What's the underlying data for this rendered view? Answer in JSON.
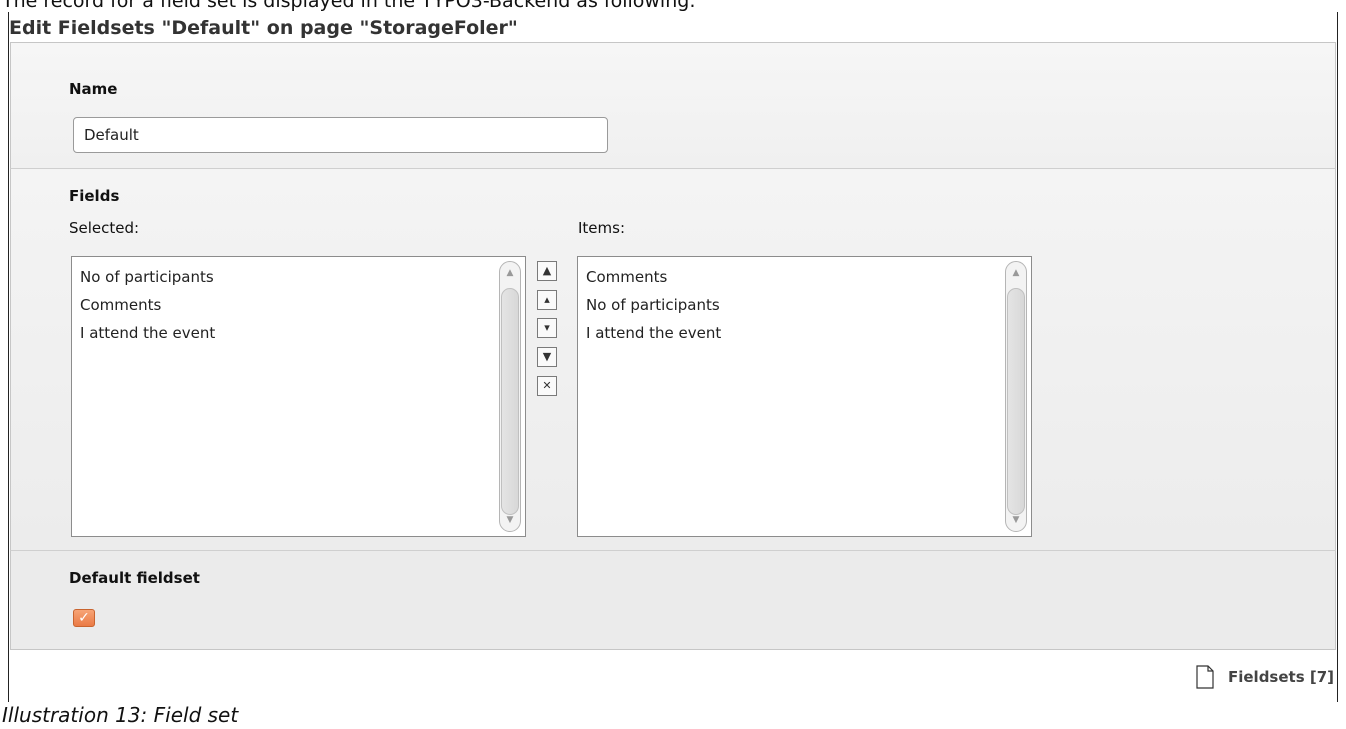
{
  "intro_text": "The record for a field set is displayed in the TYPO3-Backend as following:",
  "header": {
    "title": "Edit Fieldsets \"Default\" on page \"StorageFoler\""
  },
  "name_section": {
    "label": "Name",
    "value": "Default"
  },
  "fields_section": {
    "label": "Fields",
    "selected_label": "Selected:",
    "items_label": "Items:",
    "selected_items": [
      "No of participants",
      "Comments",
      "I attend the event"
    ],
    "available_items": [
      "Comments",
      "No of participants",
      "I attend the event"
    ],
    "controls": [
      {
        "name": "move-top-button",
        "glyph": "▲",
        "icon": "move-to-top-icon"
      },
      {
        "name": "move-up-button",
        "glyph": "▴",
        "icon": "move-up-icon"
      },
      {
        "name": "move-down-button",
        "glyph": "▾",
        "icon": "move-down-icon"
      },
      {
        "name": "move-bottom-button",
        "glyph": "▼",
        "icon": "move-to-bottom-icon"
      },
      {
        "name": "remove-button",
        "glyph": "✕",
        "icon": "remove-icon"
      }
    ]
  },
  "default_section": {
    "label": "Default fieldset",
    "checked": true
  },
  "footer": {
    "link_label": "Fieldsets [7]",
    "icon": "document-icon"
  },
  "caption": "Illustration 13: Field set",
  "colors": {
    "checkbox_accent": "#ea7a45",
    "panel_background": "#eeeeee"
  }
}
